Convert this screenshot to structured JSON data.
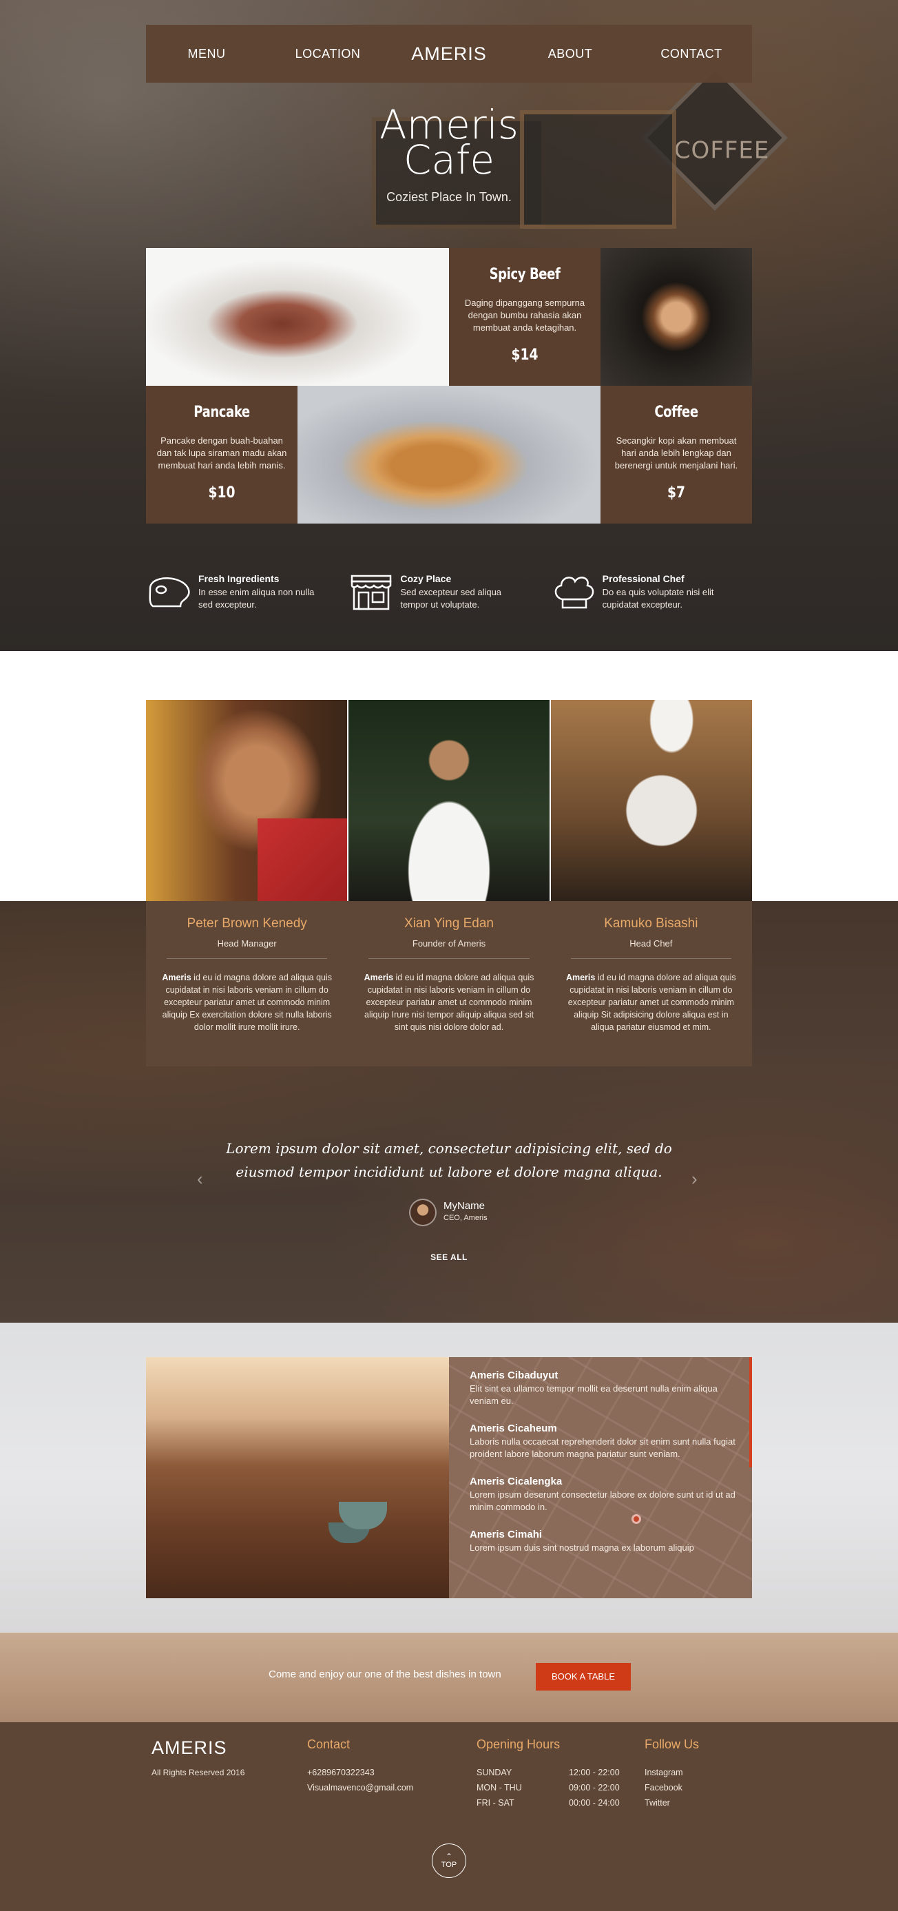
{
  "nav": {
    "items": [
      "MENU",
      "LOCATION",
      "AMERIS",
      "ABOUT",
      "CONTACT"
    ]
  },
  "hero": {
    "title_line1": "Ameris",
    "title_line2": "Cafe",
    "subtitle": "Coziest Place In Town.",
    "sign_text": "COFFEE"
  },
  "menu_items": [
    {
      "name": "Spicy Beef",
      "description": "Daging dipanggang sempurna dengan bumbu rahasia akan membuat anda ketagihan.",
      "price": "$14"
    },
    {
      "name": "Pancake",
      "description": "Pancake dengan buah-buahan dan tak lupa siraman madu akan membuat hari anda lebih manis.",
      "price": "$10"
    },
    {
      "name": "Coffee",
      "description": "Secangkir kopi akan membuat hari anda lebih lengkap dan berenergi untuk menjalani hari.",
      "price": "$7"
    }
  ],
  "features": [
    {
      "icon": "meat-icon",
      "title": "Fresh Ingredients",
      "text": "In esse enim aliqua non nulla sed excepteur."
    },
    {
      "icon": "shop-icon",
      "title": "Cozy Place",
      "text": "Sed excepteur sed aliqua tempor ut voluptate."
    },
    {
      "icon": "chef-hat-icon",
      "title": "Professional Chef",
      "text": "Do ea quis voluptate nisi elit cupidatat excepteur."
    }
  ],
  "team": [
    {
      "name": "Peter Brown Kenedy",
      "role": "Head Manager",
      "brand": "Ameris",
      "bio": " id eu id magna dolore ad aliqua quis cupidatat in nisi laboris veniam in cillum do excepteur pariatur amet ut commodo minim aliquip Ex exercitation dolore sit nulla laboris dolor mollit irure mollit irure."
    },
    {
      "name": "Xian Ying Edan",
      "role": "Founder of Ameris",
      "brand": "Ameris",
      "bio": " id eu id magna dolore ad aliqua quis cupidatat in nisi laboris veniam in cillum do excepteur pariatur amet ut commodo minim aliquip Irure nisi tempor aliquip aliqua sed sit sint quis nisi dolore dolor ad."
    },
    {
      "name": "Kamuko Bisashi",
      "role": "Head Chef",
      "brand": "Ameris",
      "bio": " id eu id magna dolore ad aliqua quis cupidatat in nisi laboris veniam in cillum do excepteur pariatur amet ut commodo minim aliquip Sit adipisicing dolore aliqua est in aliqua pariatur eiusmod et mim."
    }
  ],
  "testimonial": {
    "quote_line1": "Lorem ipsum dolor sit amet, consectetur adipisicing elit, sed do",
    "quote_line2": "eiusmod tempor incididunt ut labore et dolore magna aliqua.",
    "author": "MyName",
    "position": "CEO, Ameris",
    "see_all": "SEE ALL",
    "prev": "‹",
    "next": "›"
  },
  "locations": [
    {
      "name": "Ameris Cibaduyut",
      "text": "Elit sint ea ullamco tempor mollit ea deserunt nulla enim aliqua veniam eu."
    },
    {
      "name": "Ameris Cicaheum",
      "text": "Laboris nulla occaecat reprehenderit dolor sit enim sunt nulla fugiat proident labore laborum magna pariatur sunt veniam."
    },
    {
      "name": "Ameris Cicalengka",
      "text": "Lorem ipsum deserunt consectetur labore ex dolore sunt ut id ut ad minim commodo in."
    },
    {
      "name": "Ameris Cimahi",
      "text": "Lorem ipsum duis sint nostrud magna ex laborum aliquip"
    }
  ],
  "booking": {
    "text": "Come and enjoy our one of the best dishes in town",
    "button": "BOOK A TABLE"
  },
  "footer": {
    "brand": "AMERIS",
    "copyright": "All Rights Reserved 2016",
    "contact_title": "Contact",
    "phone": "+6289670322343",
    "email": "Visualmavenco@gmail.com",
    "hours_title": "Opening Hours",
    "hours": [
      {
        "days": "SUNDAY",
        "time": "12:00 - 22:00"
      },
      {
        "days": "MON - THU",
        "time": "09:00 - 22:00"
      },
      {
        "days": "FRI - SAT",
        "time": "00:00 - 24:00"
      }
    ],
    "follow_title": "Follow Us",
    "social": [
      "Instagram",
      "Facebook",
      "Twitter"
    ],
    "top_label": "TOP",
    "top_icon": "chevron-up-icon"
  },
  "colors": {
    "brown": "#5b3f2e",
    "accent": "#e7a868",
    "button": "#cf3a17"
  }
}
